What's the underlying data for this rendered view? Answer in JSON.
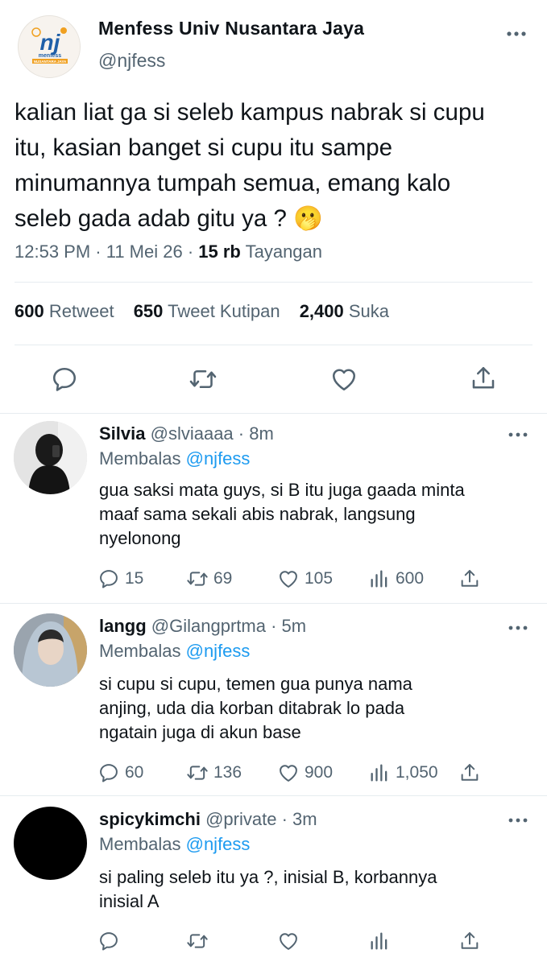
{
  "main_tweet": {
    "author_name": "Menfess Univ Nusantara Jaya",
    "handle": "@njfess",
    "avatar_logo": {
      "letters": "nj",
      "word": "menfess",
      "banner": "NUSANTARA JAYA"
    },
    "text_lines": [
      "kalian liat ga si seleb kampus nabrak si cupu",
      "itu, kasian banget si cupu itu sampe",
      "minumannya tumpah semua, emang kalo",
      "seleb gada adab gitu ya ? 🫢"
    ],
    "time": "12:53 PM",
    "date": "11 Mei 26",
    "views_count": "15 rb",
    "views_label": "Tayangan",
    "retweets_count": "600",
    "retweets_label": "Retweet",
    "quotes_count": "650",
    "quotes_label": "Tweet Kutipan",
    "likes_count": "2,400",
    "likes_label": "Suka"
  },
  "replies": [
    {
      "name": "Silvia",
      "handle": "@slviaaaa",
      "time": "8m",
      "replying_label": "Membalas",
      "replying_to": "@njfess",
      "text_lines": [
        "gua saksi mata guys, si B itu juga gaada minta",
        "maaf sama sekali abis nabrak, langsung",
        "nyelonong"
      ],
      "replies": "15",
      "retweets": "69",
      "likes": "105",
      "views": "600"
    },
    {
      "name": "langg",
      "handle": "@Gilangprtma",
      "time": "5m",
      "replying_label": "Membalas",
      "replying_to": "@njfess",
      "text_lines": [
        "si cupu si cupu, temen gua punya nama",
        "anjing, uda dia korban ditabrak lo pada",
        "ngatain juga di akun base"
      ],
      "replies": "60",
      "retweets": "136",
      "likes": "900",
      "views": "1,050"
    },
    {
      "name": "spicykimchi",
      "handle": "@private",
      "time": "3m",
      "replying_label": "Membalas",
      "replying_to": "@njfess",
      "text_lines": [
        "si paling seleb itu ya ?, inisial B, korbannya",
        "inisial A"
      ],
      "replies": "",
      "retweets": "",
      "likes": "",
      "views": ""
    }
  ],
  "separator": " · ",
  "colors": {
    "text": "#0f1419",
    "secondary": "#536471",
    "link": "#1d9bf0",
    "divider": "#e6ecf0",
    "logo_blue": "#1f5fa8",
    "logo_orange": "#f0a020"
  }
}
